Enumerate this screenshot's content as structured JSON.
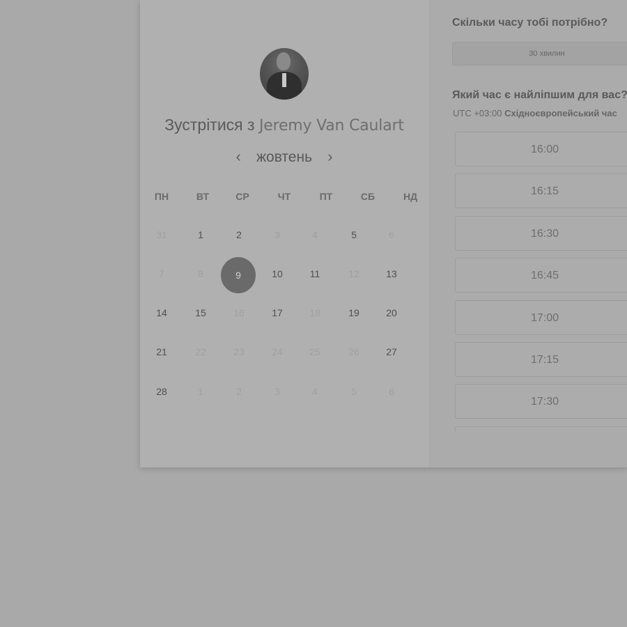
{
  "profile": {
    "title_prefix": "Зустрітися з",
    "name": "Jeremy Van Caulart"
  },
  "calendar": {
    "month": "жовтень",
    "prev_icon": "chevron-left-icon",
    "next_icon": "chevron-right-icon",
    "weekdays": [
      "ПН",
      "ВТ",
      "СР",
      "ЧТ",
      "ПТ",
      "СБ",
      "НД"
    ],
    "weeks": [
      [
        {
          "d": "31",
          "s": "disabled"
        },
        {
          "d": "1",
          "s": "avail"
        },
        {
          "d": "2",
          "s": "avail"
        },
        {
          "d": "3",
          "s": "disabled"
        },
        {
          "d": "4",
          "s": "disabled"
        },
        {
          "d": "5",
          "s": "avail"
        },
        {
          "d": "6",
          "s": "disabled"
        }
      ],
      [
        {
          "d": "7",
          "s": "disabled"
        },
        {
          "d": "8",
          "s": "disabled"
        },
        {
          "d": "9",
          "s": "selected"
        },
        {
          "d": "10",
          "s": "avail"
        },
        {
          "d": "11",
          "s": "avail"
        },
        {
          "d": "12",
          "s": "disabled"
        },
        {
          "d": "13",
          "s": "avail"
        }
      ],
      [
        {
          "d": "14",
          "s": "avail"
        },
        {
          "d": "15",
          "s": "avail"
        },
        {
          "d": "16",
          "s": "disabled"
        },
        {
          "d": "17",
          "s": "avail"
        },
        {
          "d": "18",
          "s": "disabled"
        },
        {
          "d": "19",
          "s": "avail"
        },
        {
          "d": "20",
          "s": "avail"
        }
      ],
      [
        {
          "d": "21",
          "s": "avail"
        },
        {
          "d": "22",
          "s": "disabled"
        },
        {
          "d": "23",
          "s": "disabled"
        },
        {
          "d": "24",
          "s": "disabled"
        },
        {
          "d": "25",
          "s": "disabled"
        },
        {
          "d": "26",
          "s": "disabled"
        },
        {
          "d": "27",
          "s": "avail"
        }
      ],
      [
        {
          "d": "28",
          "s": "avail"
        },
        {
          "d": "1",
          "s": "disabled"
        },
        {
          "d": "2",
          "s": "disabled"
        },
        {
          "d": "3",
          "s": "disabled"
        },
        {
          "d": "4",
          "s": "disabled"
        },
        {
          "d": "5",
          "s": "disabled"
        },
        {
          "d": "6",
          "s": "disabled"
        }
      ]
    ]
  },
  "booking": {
    "duration_question": "Скільки часу тобі потрібно?",
    "duration_value": "30 хвилин",
    "time_question": "Який час є найліпшим для вас?",
    "timezone_offset": "UTC +03:00",
    "timezone_name": "Східноєвропейський час",
    "slots": [
      "16:00",
      "16:15",
      "16:30",
      "16:45",
      "17:00",
      "17:15",
      "17:30"
    ]
  }
}
